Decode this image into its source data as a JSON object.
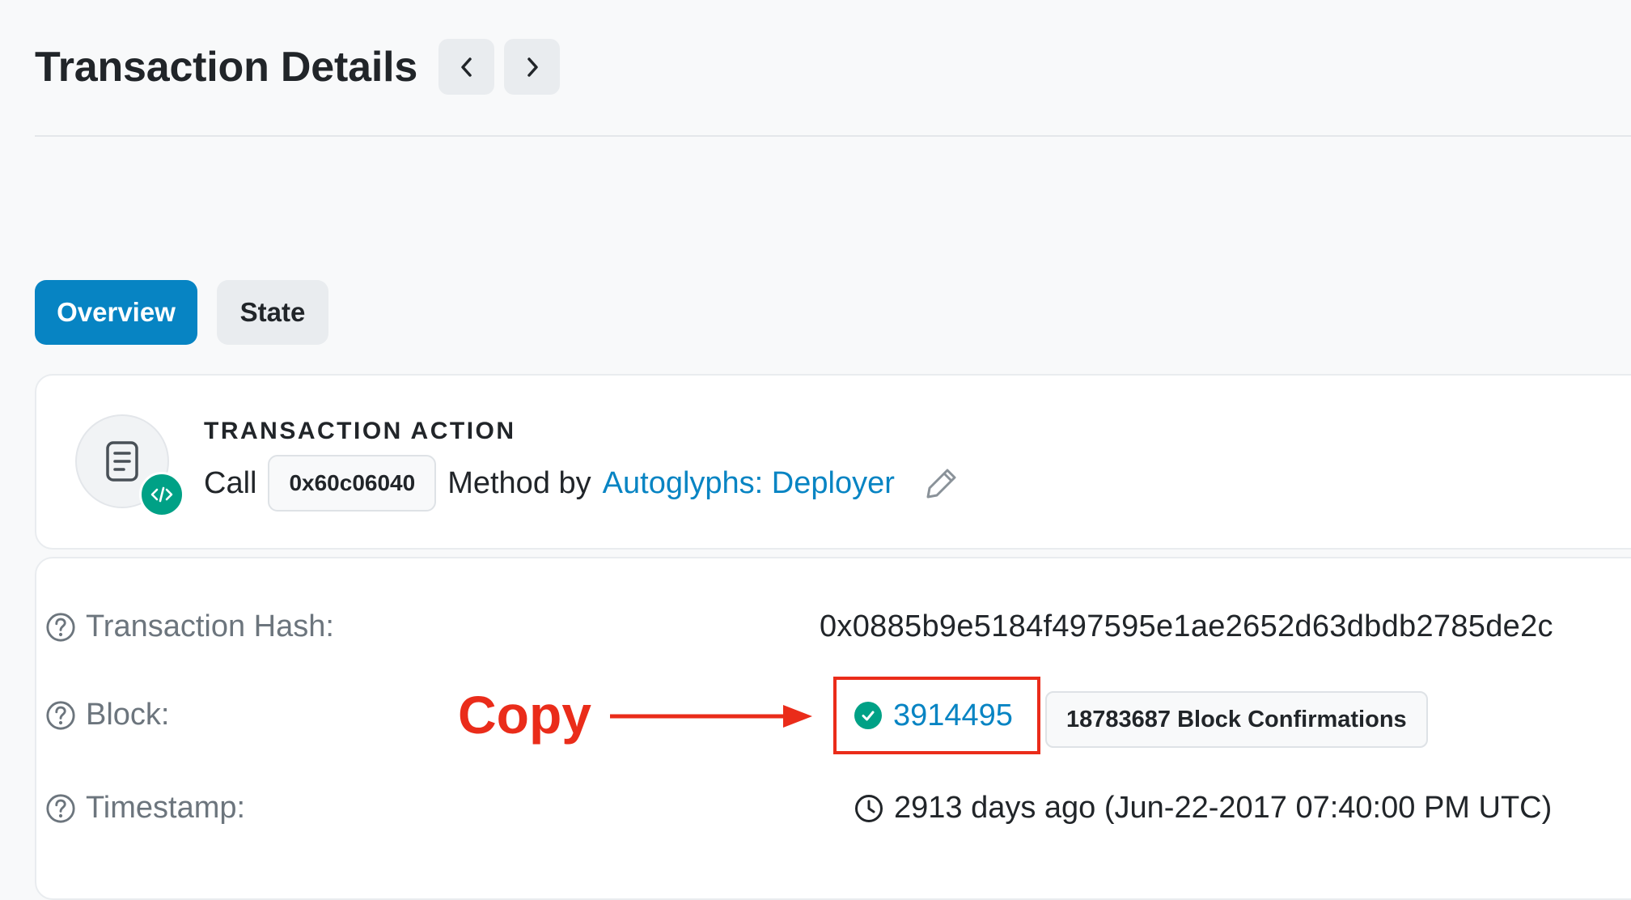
{
  "header": {
    "title": "Transaction Details",
    "prev_icon": "chevron-left-icon",
    "next_icon": "chevron-right-icon"
  },
  "tabs": [
    {
      "label": "Overview",
      "active": true
    },
    {
      "label": "State",
      "active": false
    }
  ],
  "transaction_action": {
    "heading": "TRANSACTION ACTION",
    "call_label": "Call",
    "method": "0x60c06040",
    "method_by_label": "Method by",
    "deployer": "Autoglyphs: Deployer",
    "icons": [
      "document-icon",
      "code-icon",
      "pencil-icon"
    ]
  },
  "details": {
    "hash_label": "Transaction Hash:",
    "hash_value": "0x0885b9e5184f497595e1ae2652d63dbdb2785de2c",
    "block_label": "Block:",
    "block_number": "3914495",
    "block_confirmations": "18783687 Block Confirmations",
    "timestamp_label": "Timestamp:",
    "timestamp_value": "2913 days ago (Jun-22-2017 07:40:00 PM UTC)"
  },
  "annotation": {
    "label": "Copy",
    "color": "#ea2c1a"
  },
  "colors": {
    "accent": "#0784c3",
    "success": "#00a186",
    "annotation": "#ea2c1a"
  }
}
